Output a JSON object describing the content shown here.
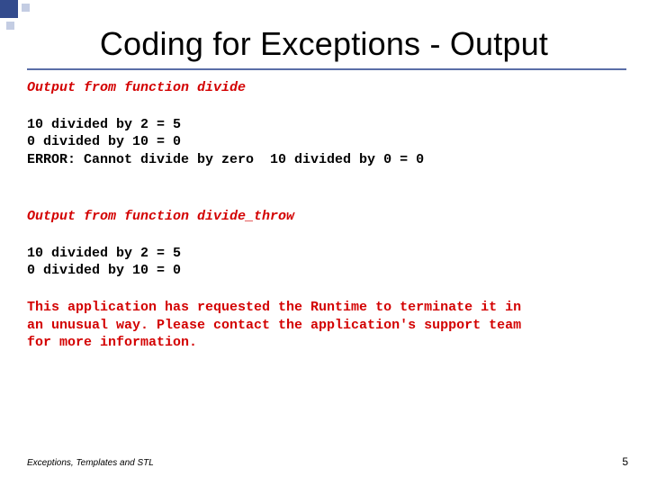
{
  "title": "Coding for Exceptions - Output",
  "section1_header": "Output from function divide",
  "section1_lines": "10 divided by 2 = 5\n0 divided by 10 = 0\nERROR: Cannot divide by zero  10 divided by 0 = 0",
  "section2_header": "Output from function divide_throw",
  "section2_lines": "10 divided by 2 = 5\n0 divided by 10 = 0",
  "section2_message": "This application has requested the Runtime to terminate it in\nan unusual way. Please contact the application's support team\nfor more information.",
  "footer": "Exceptions, Templates and STL",
  "page_number": "5"
}
